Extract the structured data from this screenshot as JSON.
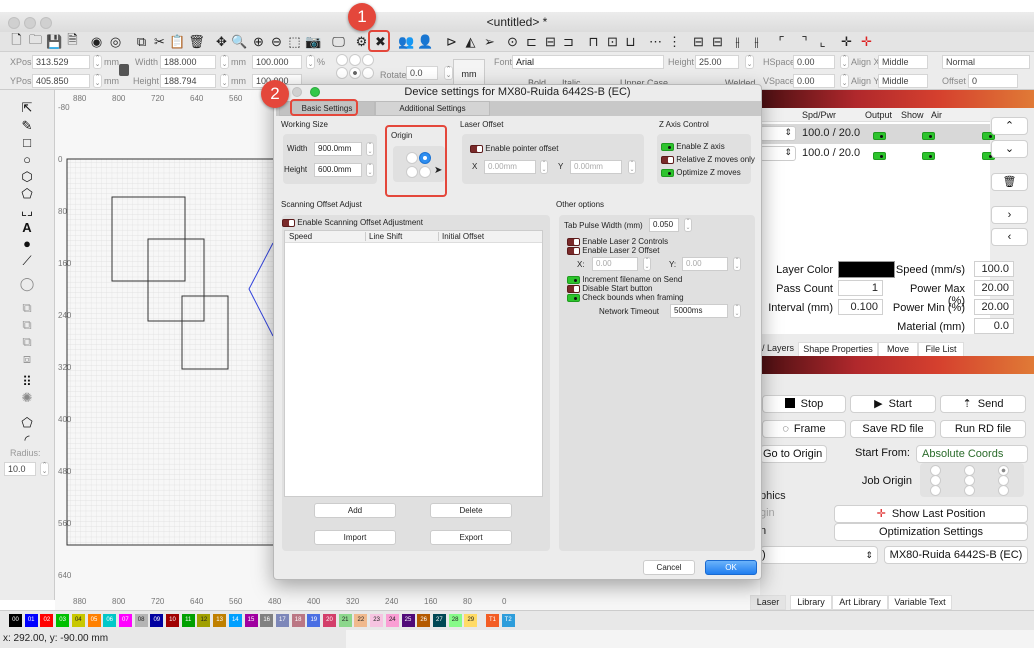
{
  "window": {
    "title": "<untitled> *"
  },
  "toolbar": {
    "icons": [
      "new-file-icon",
      "open-file-icon",
      "save-icon",
      "save-as-icon",
      "undo-icon",
      "redo-icon",
      "copy-icon",
      "cut-icon",
      "paste-icon",
      "delete-icon",
      "move-icon",
      "zoom-fit-icon",
      "zoom-in-icon",
      "zoom-out-icon",
      "select-frame-icon",
      "camera-icon",
      "monitor-icon",
      "machine-settings-icon",
      "device-settings-icon",
      "group-icon",
      "user-icon",
      "flip-h-icon",
      "mirror-icon",
      "send-icon",
      "target-icon",
      "align-left-icon",
      "align-center-icon",
      "align-right-icon",
      "align-top-icon",
      "align-middle-icon",
      "align-bottom-icon",
      "distribute-h-icon",
      "distribute-v-icon",
      "dock-icon-1",
      "dock-icon-2",
      "dock-icon-3",
      "dock-icon-4",
      "corner-tl-icon",
      "corner-tr-icon",
      "corner-bl-icon",
      "center-icon",
      "laser-position-icon"
    ]
  },
  "props": {
    "xpos_label": "XPos",
    "xpos": "313.529",
    "ypos_label": "YPos",
    "ypos": "405.850",
    "unit": "mm",
    "width_label": "Width",
    "width": "188.000",
    "height_label": "Height",
    "height": "188.794",
    "scale_w": "100.000",
    "scale_h": "100.000",
    "pct": "%",
    "rotate_label": "Rotate",
    "rotate": "0.0",
    "unit_button": "mm",
    "font_label": "Font",
    "font": "Arial",
    "font_height_label": "Height",
    "font_height": "25.00",
    "hspace_label": "HSpace",
    "hspace": "0.00",
    "vspace_label": "VSpace",
    "vspace": "0.00",
    "alignx_label": "Align X",
    "alignx": "Middle",
    "aligny_label": "Align Y",
    "aligny": "Middle",
    "style": "Normal",
    "offset_label": "Offset",
    "offset": "0",
    "bold": "Bold",
    "italic": "Italic",
    "upper": "Upper Case",
    "welded": "Welded"
  },
  "left_tools": {
    "radius_label": "Radius:",
    "radius": "10.0"
  },
  "canvas": {
    "x_ticks": [
      "880",
      "800",
      "720",
      "640",
      "560",
      "480",
      "400",
      "320",
      "240",
      "160",
      "80",
      "0"
    ],
    "y_ticks": [
      "-80",
      "0",
      "80",
      "160",
      "240",
      "320",
      "400",
      "480",
      "560",
      "640"
    ]
  },
  "dialog": {
    "title": "Device settings for MX80-Ruida 6442S-B (EC)",
    "tabs": [
      "Basic Settings",
      "Additional Settings"
    ],
    "working_size": {
      "title": "Working Size",
      "width_label": "Width",
      "width": "900.0mm",
      "height_label": "Height",
      "height": "600.0mm"
    },
    "origin": {
      "title": "Origin",
      "selected": "top-right"
    },
    "laser_offset": {
      "title": "Laser Offset",
      "enable_label": "Enable pointer offset",
      "enabled": false,
      "x_label": "X",
      "x": "0.00mm",
      "y_label": "Y",
      "y": "0.00mm"
    },
    "z_axis": {
      "title": "Z Axis Control",
      "items": [
        {
          "label": "Enable Z axis",
          "on": true
        },
        {
          "label": "Relative Z moves only",
          "on": false
        },
        {
          "label": "Optimize Z moves",
          "on": true
        }
      ]
    },
    "scanning": {
      "title": "Scanning Offset Adjust",
      "enable_label": "Enable Scanning Offset Adjustment",
      "enabled": false,
      "columns": [
        "Speed",
        "Line Shift",
        "Initial Offset"
      ],
      "buttons": [
        "Add",
        "Delete",
        "Import",
        "Export"
      ]
    },
    "other": {
      "title": "Other options",
      "tab_pulse_label": "Tab Pulse Width (mm)",
      "tab_pulse": "0.050",
      "laser2_controls": "Enable Laser 2 Controls",
      "laser2_offset": "Enable Laser 2 Offset",
      "x_label": "X:",
      "x": "0.00",
      "y_label": "Y:",
      "y": "0.00",
      "increment": "Increment filename on Send",
      "disable_start": "Disable Start button",
      "check_bounds": "Check bounds when framing",
      "timeout_label": "Network Timeout",
      "timeout": "5000ms"
    },
    "cancel": "Cancel",
    "ok": "OK"
  },
  "layers": {
    "columns": [
      "Spd/Pwr",
      "Output",
      "Show",
      "Air"
    ],
    "rows": [
      {
        "spdpwr": "100.0 / 20.0",
        "output": true,
        "show": true,
        "air": true
      },
      {
        "spdpwr": "100.0 / 20.0",
        "output": true,
        "show": true,
        "air": true
      }
    ]
  },
  "layer_props": {
    "layer_color_label": "Layer Color",
    "layer_color": "#000000",
    "pass_label": "Pass Count",
    "pass": "1",
    "interval_label": "Interval (mm)",
    "interval": "0.100",
    "speed_label": "Speed (mm/s)",
    "speed": "100.0",
    "pmax_label": "Power Max (%)",
    "pmax": "20.00",
    "pmin_label": "Power Min (%)",
    "pmin": "20.00",
    "material_label": "Material (mm)",
    "material": "0.0"
  },
  "mid_tabs": [
    "/ Layers",
    "Shape Properties",
    "Move",
    "File List"
  ],
  "laser_panel": {
    "stop": "Stop",
    "start": "Start",
    "send": "Send",
    "frame": "Frame",
    "save_rd": "Save RD file",
    "run_rd": "Run RD file",
    "go_origin": "Go to Origin",
    "start_from_label": "Start From:",
    "start_from": "Absolute Coords",
    "job_origin_label": "Job Origin",
    "partial_1": "phics",
    "partial_2": "gin",
    "partial_3": "n",
    "show_last": "Show Last Position",
    "optimization": "Optimization Settings",
    "port_partial": ")",
    "device": "MX80-Ruida 6442S-B (EC)"
  },
  "bottom_tabs": [
    "Laser",
    "Library",
    "Art Library",
    "Variable Text"
  ],
  "palette": [
    {
      "label": "00",
      "color": "#000000"
    },
    {
      "label": "01",
      "color": "#0000ff"
    },
    {
      "label": "02",
      "color": "#ff0000"
    },
    {
      "label": "03",
      "color": "#00c000"
    },
    {
      "label": "04",
      "color": "#c8c800"
    },
    {
      "label": "05",
      "color": "#ff8000"
    },
    {
      "label": "06",
      "color": "#00c8c8"
    },
    {
      "label": "07",
      "color": "#ff00ff"
    },
    {
      "label": "08",
      "color": "#b4b4b4"
    },
    {
      "label": "09",
      "color": "#0000a0"
    },
    {
      "label": "10",
      "color": "#a00000"
    },
    {
      "label": "11",
      "color": "#00a000"
    },
    {
      "label": "12",
      "color": "#a0a000"
    },
    {
      "label": "13",
      "color": "#c08000"
    },
    {
      "label": "14",
      "color": "#00a0ff"
    },
    {
      "label": "15",
      "color": "#a000a0"
    },
    {
      "label": "16",
      "color": "#808080"
    },
    {
      "label": "17",
      "color": "#7d87b9"
    },
    {
      "label": "18",
      "color": "#bb7784"
    },
    {
      "label": "19",
      "color": "#4a6fe3"
    },
    {
      "label": "20",
      "color": "#d33f6a"
    },
    {
      "label": "21",
      "color": "#8cd78c"
    },
    {
      "label": "22",
      "color": "#f0b98d"
    },
    {
      "label": "23",
      "color": "#f6c4e1"
    },
    {
      "label": "24",
      "color": "#fa9ed4"
    },
    {
      "label": "25",
      "color": "#500a78"
    },
    {
      "label": "26",
      "color": "#b45a00"
    },
    {
      "label": "27",
      "color": "#004754"
    },
    {
      "label": "28",
      "color": "#86fa88"
    },
    {
      "label": "29",
      "color": "#ffdb66"
    },
    {
      "label": "T1",
      "color": "#f35d24"
    },
    {
      "label": "T2",
      "color": "#2d9ddb"
    }
  ],
  "status": {
    "coords": "x: 292.00, y: -90.00 mm"
  },
  "annotations": {
    "badge1": "1",
    "badge2": "2"
  }
}
